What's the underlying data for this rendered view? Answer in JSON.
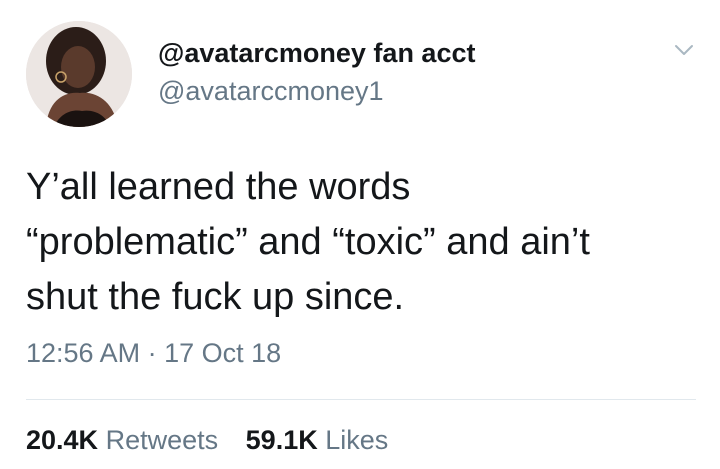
{
  "user": {
    "display_name": "@avatarcmoney fan acct",
    "handle": "@avatarccmoney1",
    "avatar_icon": "user-avatar-photo"
  },
  "menu": {
    "icon": "chevron-down-icon"
  },
  "tweet": {
    "lines": [
      "Y’all learned the words",
      "“problematic” and “toxic” and ain’t",
      "shut the fuck up since."
    ],
    "time": "12:56 AM",
    "separator": "·",
    "date": "17 Oct 18"
  },
  "stats": {
    "retweets_count": "20.4K",
    "retweets_label": "Retweets",
    "likes_count": "59.1K",
    "likes_label": "Likes"
  },
  "colors": {
    "text_primary": "#14171a",
    "text_secondary": "#657786",
    "divider": "#e1e8ed",
    "background": "#ffffff"
  }
}
